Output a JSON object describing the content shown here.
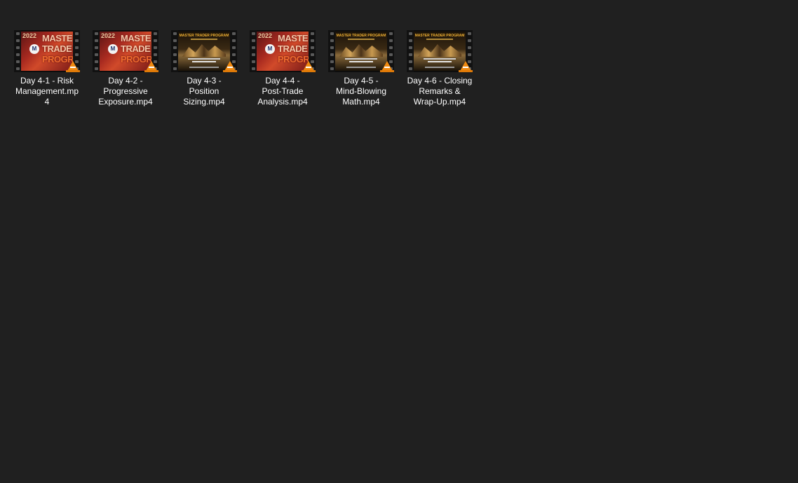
{
  "files": [
    {
      "label": "Day 4-1 - Risk\nManagement.mp\n4",
      "thumb_style": "red",
      "thumb_text": {
        "year": "2022",
        "logo": "M",
        "line1": "MASTE",
        "line2": "TRADE",
        "line3": "PROGRA"
      },
      "badge_icon": "vlc-cone-icon"
    },
    {
      "label": "Day 4-2 -\nProgressive\nExposure.mp4",
      "thumb_style": "red",
      "thumb_text": {
        "year": "2022",
        "logo": "M",
        "line1": "MASTE",
        "line2": "TRADE",
        "line3": "PROGRA"
      },
      "badge_icon": "vlc-cone-icon"
    },
    {
      "label": "Day 4-3 -\nPosition\nSizing.mp4",
      "thumb_style": "dark",
      "thumb_text": {
        "title": "MASTER TRADER PROGRAM"
      },
      "badge_icon": "vlc-cone-icon"
    },
    {
      "label": "Day 4-4 -\nPost-Trade\nAnalysis.mp4",
      "thumb_style": "red",
      "thumb_text": {
        "year": "2022",
        "logo": "M",
        "line1": "MASTE",
        "line2": "TRADE",
        "line3": "PROGRA"
      },
      "badge_icon": "vlc-cone-icon"
    },
    {
      "label": "Day 4-5 -\nMind-Blowing\nMath.mp4",
      "thumb_style": "dark",
      "thumb_text": {
        "title": "MASTER TRADER PROGRAM"
      },
      "badge_icon": "vlc-cone-icon"
    },
    {
      "label": "Day 4-6 - Closing\nRemarks &\nWrap-Up.mp4",
      "thumb_style": "dark",
      "thumb_text": {
        "title": "MASTER TRADER PROGRAM"
      },
      "badge_icon": "vlc-cone-icon"
    }
  ],
  "colors": {
    "background": "#202020",
    "text": "#ffffff",
    "vlc_orange": "#f08a10"
  }
}
